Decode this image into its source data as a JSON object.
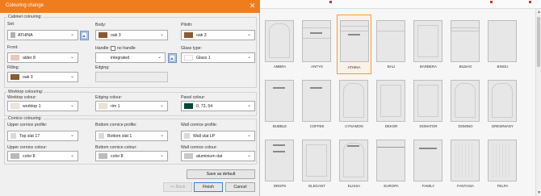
{
  "dialog": {
    "title": "Colouring change",
    "cabinet": {
      "section_label": "Cabinet colouring:",
      "set_label": "Set:",
      "set_value": "ATHINA",
      "body_label": "Body:",
      "body_value": "oak 3",
      "plinth_label": "Plinth:",
      "plinth_value": "oak 3",
      "front_label": "Front:",
      "front_value": "alder 8",
      "handle_label": "Handle:",
      "no_handle_label": "no handle",
      "handle_value": "integrated",
      "glass_label": "Glass type:",
      "glass_value": "Glass 1",
      "filling_label": "Filling:",
      "filling_value": "oak 3",
      "edging_label": "Edging:",
      "edging_value": ""
    },
    "worktop": {
      "section_label": "Worktop colouring:",
      "colour_label": "Worktop colour:",
      "colour_value": "worktop 1",
      "edging_label": "Edging colour:",
      "edging_value": "rim 1",
      "panel_label": "Panel colour:",
      "panel_value": "0, 73, 54"
    },
    "cornice": {
      "section_label": "Cornice colouring:",
      "upper_profile_label": "Upper cornice profile:",
      "upper_profile_value": "Top slat 17",
      "bottom_profile_label": "Bottom cornice profile:",
      "bottom_profile_value": "Bottom slat 1",
      "wall_profile_label": "Wall cornice profile:",
      "wall_profile_value": "Wall slat LP",
      "upper_colour_label": "Upper cornice colour:",
      "upper_colour_value": "color 8",
      "bottom_colour_label": "Bottom cornice colour:",
      "bottom_colour_value": "color 8",
      "wall_colour_label": "Wall cornice colour:",
      "wall_colour_value": "aluminium dat"
    },
    "buttons": {
      "save_default": "Save as default",
      "back": "<< Back",
      "finish": "Finish",
      "cancel": "Cancel"
    },
    "colors": {
      "body": "#8a5a32",
      "plinth": "#8a5a32",
      "front": "#e6c9bd",
      "filling": "#8a5a32",
      "worktop": "#efe7d6",
      "edging": "#ece4cf",
      "panel": "#004936",
      "upper_cornice": "#b9b9b9",
      "bottom_cornice": "#bdbdbd",
      "wall_cornice": "#c9c9c9",
      "accent": "#f07d1d"
    }
  },
  "catalog": {
    "selected": "ATHINA",
    "row1": [
      "AMBRA",
      "ANTYS",
      "ATHINA",
      "BALI",
      "BARBERA",
      "BILBAO",
      "BINGU"
    ],
    "row2": [
      "BUBBLE",
      "COFFEE",
      "CYNAMON",
      "DEKOR",
      "DOMATOR",
      "DOMINO",
      "DREWNIANY"
    ],
    "row3": [
      "DROPS",
      "ELEGANT",
      "ELISSA",
      "EUROPA",
      "FAMILY",
      "FANTASIA",
      "FELPA"
    ]
  }
}
